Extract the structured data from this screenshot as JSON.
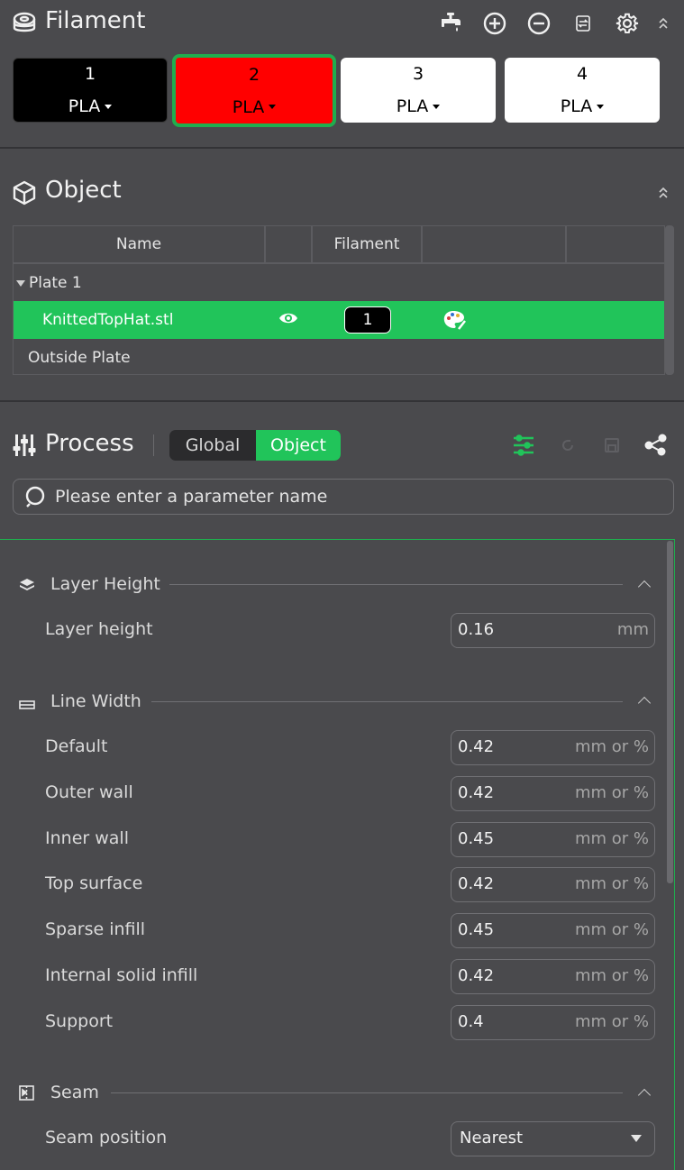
{
  "filament": {
    "title": "Filament",
    "icons": [
      "filament-spool-icon",
      "flush-tap-icon",
      "add-icon",
      "remove-icon",
      "sync-icon",
      "gear-icon",
      "collapse-icon"
    ],
    "slots": [
      {
        "number": "1",
        "material": "PLA",
        "color": "#000000",
        "text_color": "#ffffff",
        "selected": false
      },
      {
        "number": "2",
        "material": "PLA",
        "color": "#ff0000",
        "text_color": "#000000",
        "selected": true
      },
      {
        "number": "3",
        "material": "PLA",
        "color": "#ffffff",
        "text_color": "#000000",
        "selected": false
      },
      {
        "number": "4",
        "material": "PLA",
        "color": "#ffffff",
        "text_color": "#000000",
        "selected": false
      }
    ]
  },
  "object": {
    "title": "Object",
    "columns": {
      "name": "Name",
      "filament": "Filament"
    },
    "rows": [
      {
        "label": "Plate 1"
      },
      {
        "label": "KnittedTopHat.stl",
        "filament": "1",
        "selected": true
      },
      {
        "label": "Outside Plate"
      }
    ]
  },
  "process": {
    "title": "Process",
    "toggle": {
      "global": "Global",
      "object": "Object",
      "active": "Object"
    },
    "search_placeholder": "Please enter a parameter name",
    "groups": {
      "layer_height": {
        "title": "Layer Height",
        "items": [
          {
            "label": "Layer height",
            "value": "0.16",
            "unit": "mm"
          }
        ]
      },
      "line_width": {
        "title": "Line Width",
        "items": [
          {
            "label": "Default",
            "value": "0.42",
            "unit": "mm or %"
          },
          {
            "label": "Outer wall",
            "value": "0.42",
            "unit": "mm or %"
          },
          {
            "label": "Inner wall",
            "value": "0.45",
            "unit": "mm or %"
          },
          {
            "label": "Top surface",
            "value": "0.42",
            "unit": "mm or %"
          },
          {
            "label": "Sparse infill",
            "value": "0.45",
            "unit": "mm or %"
          },
          {
            "label": "Internal solid infill",
            "value": "0.42",
            "unit": "mm or %"
          },
          {
            "label": "Support",
            "value": "0.4",
            "unit": "mm or %"
          }
        ]
      },
      "seam": {
        "title": "Seam",
        "items": [
          {
            "label": "Seam position",
            "value": "Nearest"
          }
        ]
      }
    }
  },
  "colors": {
    "accent": "#21c45a",
    "background": "#4a4a4d",
    "selected_border": "#1fae4e"
  }
}
